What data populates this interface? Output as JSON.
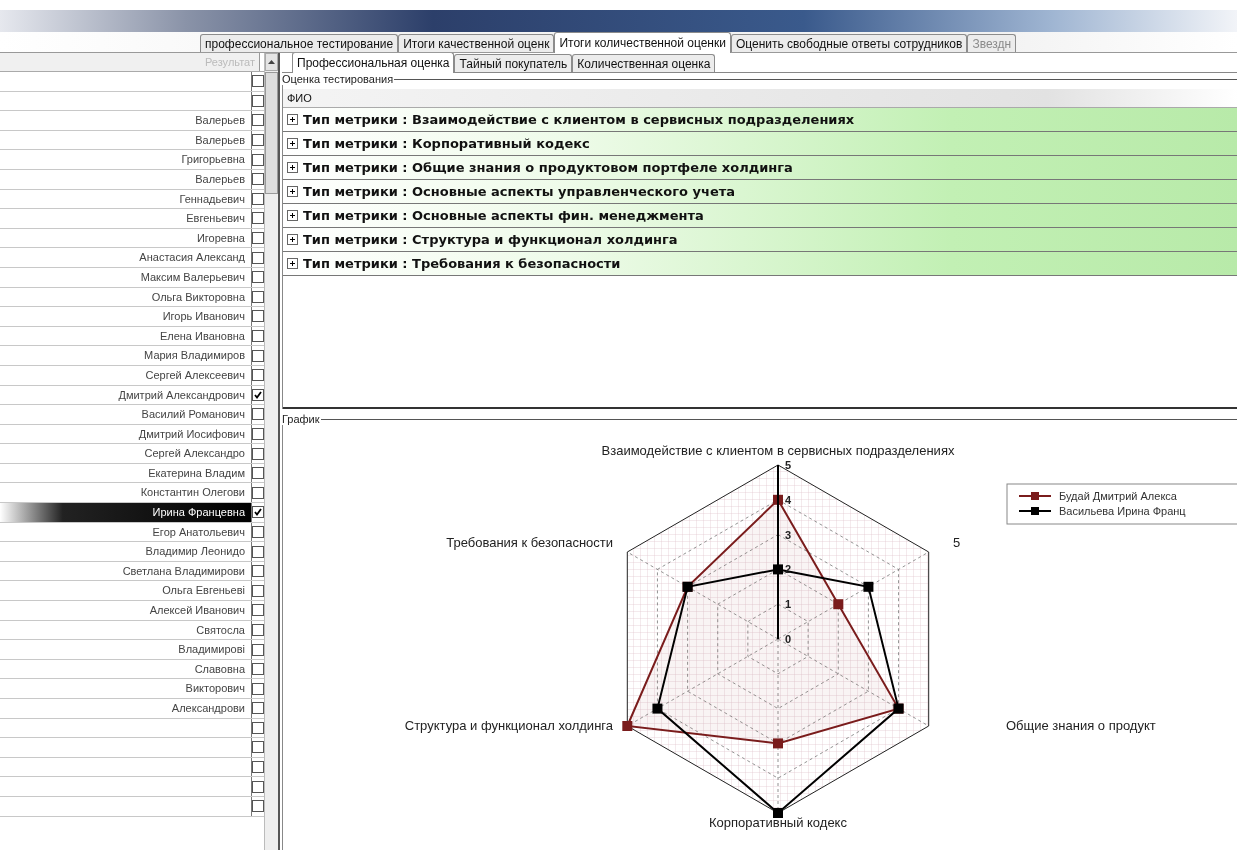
{
  "main_tabs": [
    {
      "label": "профессиональное тестирование",
      "selected": false,
      "faded": false
    },
    {
      "label": "Итоги качественной оценк",
      "selected": false,
      "faded": false
    },
    {
      "label": "Итоги количественной оценки",
      "selected": true,
      "faded": false
    },
    {
      "label": "Оценить свободные ответы сотрудников",
      "selected": false,
      "faded": false
    },
    {
      "label": "Звездн",
      "selected": false,
      "faded": true
    }
  ],
  "employee_list": {
    "column": "Результат",
    "rows": [
      {
        "checked": false,
        "selected": false
      },
      {
        "checked": false,
        "selected": false
      },
      {
        "name": "Валерьев",
        "checked": false,
        "selected": false
      },
      {
        "name": "Валерьев",
        "checked": false,
        "selected": false
      },
      {
        "name": "Григорьевна",
        "checked": false,
        "selected": false
      },
      {
        "name": "Валерьев",
        "checked": false,
        "selected": false
      },
      {
        "name": "Геннадьевич",
        "checked": false,
        "selected": false
      },
      {
        "name": "Евгеньевич",
        "checked": false,
        "selected": false
      },
      {
        "name": "Игоревна",
        "checked": false,
        "selected": false
      },
      {
        "name": "Анастасия Александ",
        "checked": false,
        "selected": false
      },
      {
        "name": "Максим Валерьевич",
        "checked": false,
        "selected": false
      },
      {
        "name": "Ольга Викторовна",
        "checked": false,
        "selected": false
      },
      {
        "name": "Игорь Иванович",
        "checked": false,
        "selected": false
      },
      {
        "name": "Елена Ивановна",
        "checked": false,
        "selected": false
      },
      {
        "name": "Мария Владимиров",
        "checked": false,
        "selected": false
      },
      {
        "name": "Сергей Алексеевич",
        "checked": false,
        "selected": false
      },
      {
        "name": "Дмитрий Александрович",
        "checked": true,
        "selected": false
      },
      {
        "name": "Василий Романович",
        "checked": false,
        "selected": false
      },
      {
        "name": "Дмитрий Иосифович",
        "checked": false,
        "selected": false
      },
      {
        "name": "Сергей Александро",
        "checked": false,
        "selected": false
      },
      {
        "name": "Екатерина Владим",
        "checked": false,
        "selected": false
      },
      {
        "name": "Константин Олегови",
        "checked": false,
        "selected": false
      },
      {
        "name": "Ирина Францевна",
        "checked": true,
        "selected": true
      },
      {
        "name": "Егор Анатольевич",
        "checked": false,
        "selected": false
      },
      {
        "name": "Владимир Леонидо",
        "checked": false,
        "selected": false
      },
      {
        "name": "Светлана Владимирови",
        "checked": false,
        "selected": false
      },
      {
        "name": "Ольга Евгеньеві",
        "checked": false,
        "selected": false
      },
      {
        "name": "Алексей Иванович",
        "checked": false,
        "selected": false
      },
      {
        "name": "Святосла",
        "checked": false,
        "selected": false
      },
      {
        "name": "Владимирові",
        "checked": false,
        "selected": false
      },
      {
        "name": "Славовна",
        "checked": false,
        "selected": false
      },
      {
        "name": "Викторович",
        "checked": false,
        "selected": false
      },
      {
        "name": "Александрови",
        "checked": false,
        "selected": false
      },
      {
        "checked": false,
        "selected": false
      },
      {
        "checked": false,
        "selected": false
      },
      {
        "checked": false,
        "selected": false
      },
      {
        "checked": false,
        "selected": false
      },
      {
        "checked": false,
        "selected": false
      }
    ]
  },
  "sub_tabs": [
    {
      "label": "Профессиональная оценка",
      "selected": true
    },
    {
      "label": "Тайный покупатель",
      "selected": false
    },
    {
      "label": "Количественная оценка",
      "selected": false
    }
  ],
  "testing_group": {
    "title": "Оценка тестирования",
    "column": "ФИО",
    "rows": [
      {
        "label": "Тип метрики : Взаимодействие с клиентом в сервисных подразделениях",
        "expanded": false
      },
      {
        "label": "Тип метрики : Корпоративный кодекс",
        "expanded": false
      },
      {
        "label": "Тип метрики : Общие знания о продуктовом портфеле холдинга",
        "expanded": false
      },
      {
        "label": "Тип метрики : Основные аспекты управленческого учета",
        "expanded": false
      },
      {
        "label": "Тип метрики : Основные аспекты фин. менеджмента",
        "expanded": false
      },
      {
        "label": "Тип метрики : Структура и функционал холдинга",
        "expanded": false
      },
      {
        "label": "Тип метрики : Требования к безопасности",
        "expanded": false
      }
    ]
  },
  "chart_group": {
    "title": "График",
    "radar": {
      "axes": [
        "Взаимодействие с клиентом в сервисных подразделениях",
        "Требования к безопасности",
        "5",
        "Структура и функционал холдинга",
        "Общие знания о продукт",
        "Корпоративный кодекс"
      ],
      "ticks": [
        "5",
        "4",
        "3",
        "2",
        "1",
        "0"
      ],
      "series": [
        {
          "name": "Будай Дмитрий Алекса",
          "color": "#7a1c1c"
        },
        {
          "name": "Васильева Ирина Франц",
          "color": "#000000"
        }
      ]
    }
  }
}
